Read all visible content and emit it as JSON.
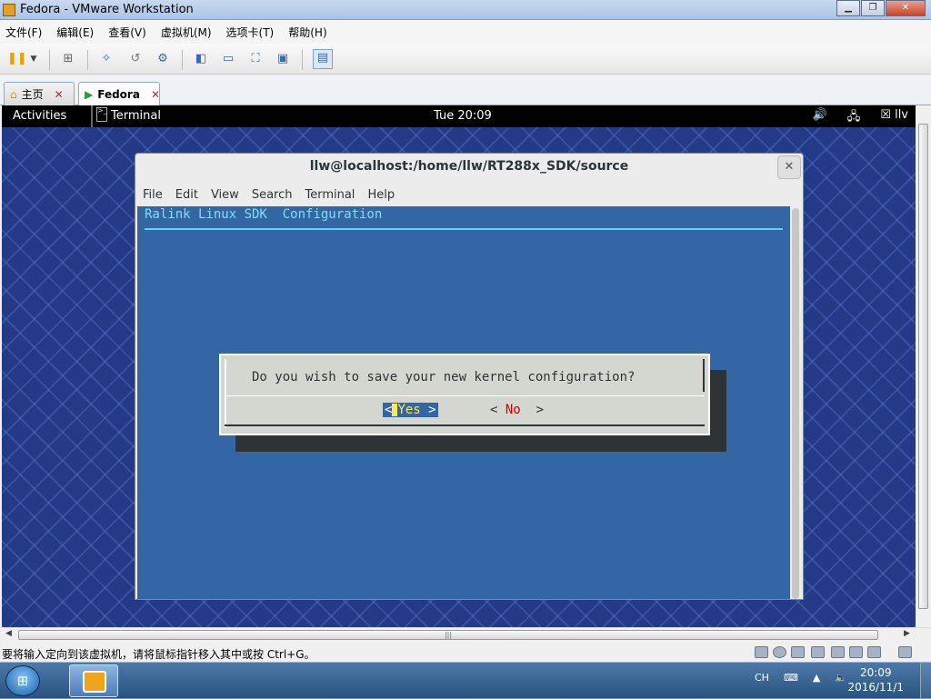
{
  "window": {
    "title": "Fedora - VMware Workstation"
  },
  "menubar": [
    "文件(F)",
    "编辑(E)",
    "查看(V)",
    "虚拟机(M)",
    "选项卡(T)",
    "帮助(H)"
  ],
  "tabs": [
    {
      "label": "主页",
      "active": false
    },
    {
      "label": "Fedora",
      "active": true
    }
  ],
  "guest": {
    "activities": "Activities",
    "app_label": "Terminal",
    "clock": "Tue 20:09",
    "user": "llv"
  },
  "terminal": {
    "title": "llw@localhost:/home/llw/RT288x_SDK/source",
    "menu": [
      "File",
      "Edit",
      "View",
      "Search",
      "Terminal",
      "Help"
    ],
    "sdk_title": "Ralink Linux SDK  Configuration",
    "dialog_question": "Do you wish to save your new kernel configuration?",
    "yes_left": "<",
    "yes_label": "Yes",
    "yes_right": ">",
    "no_left": "< ",
    "no_label": "No",
    "no_right": "  >"
  },
  "statusbar": {
    "text": "要将输入定向到该虚拟机，请将鼠标指针移入其中或按 Ctrl+G。"
  },
  "taskbar": {
    "lang": "CH",
    "time": "20:09",
    "date": "2016/11/1"
  },
  "colors": {
    "terminal_bg": "#3465a4",
    "dialog_bg": "#d3d7cf",
    "title_cyan": "#7ce0f6",
    "no_red": "#cc0000",
    "yes_yellow": "#fce94f"
  }
}
